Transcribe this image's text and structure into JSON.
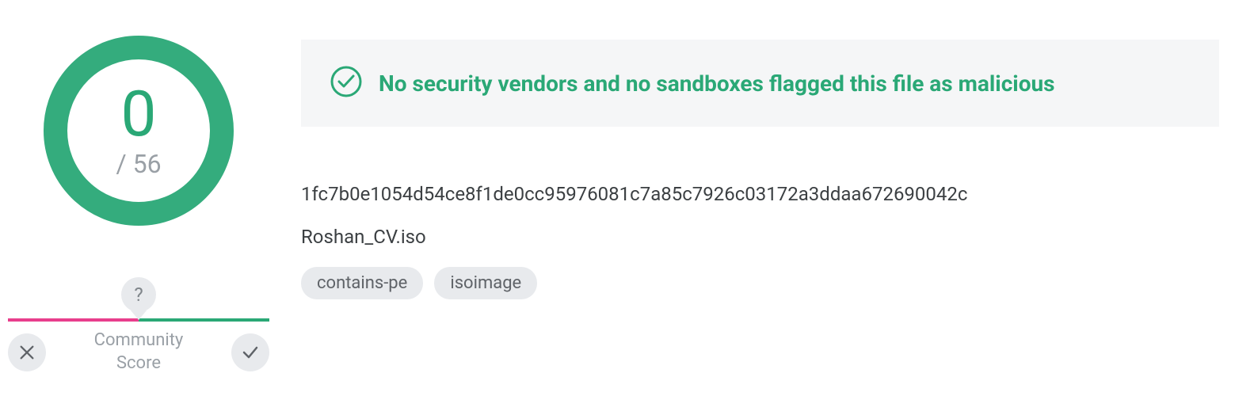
{
  "detection": {
    "count": "0",
    "total_prefix": "/ ",
    "total": "56"
  },
  "community": {
    "help": "?",
    "label_line1": "Community",
    "label_line2": "Score",
    "neg_pct": 50,
    "pos_pct": 50
  },
  "status": {
    "message": "No security vendors and no sandboxes flagged this file as malicious"
  },
  "file": {
    "hash": "1fc7b0e1054d54ce8f1de0cc95976081c7a85c7926c03172a3ddaa672690042c",
    "name": "Roshan_CV.iso"
  },
  "tags": [
    "contains-pe",
    "isoimage"
  ],
  "colors": {
    "accent_green": "#2aa876",
    "neg_pink": "#e83e8c",
    "muted_gray": "#9aa0a6"
  }
}
